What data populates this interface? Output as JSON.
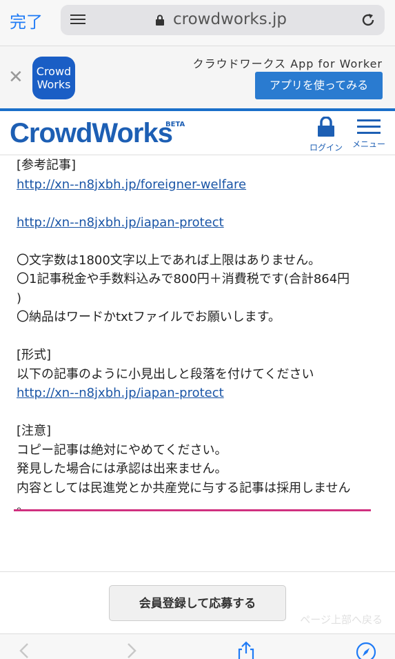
{
  "safari": {
    "done_label": "完了",
    "url": "crowdworks.jp"
  },
  "banner": {
    "logo_line1": "Crowd",
    "logo_line2": "Works",
    "title": "クラウドワークス App for Worker",
    "button_label": "アプリを使ってみる"
  },
  "header": {
    "logo_text": "CrowdWorks",
    "beta_label": "BETA",
    "login_label": "ログイン",
    "menu_label": "メニュー"
  },
  "content": {
    "lines": [
      {
        "text": "[参考記事]",
        "type": "text"
      },
      {
        "text": "http://xn--n8jxbh.jp/foreigner-welfare",
        "type": "link"
      },
      {
        "text": "",
        "type": "gap"
      },
      {
        "text": "http://xn--n8jxbh.jp/iapan-protect",
        "type": "link"
      },
      {
        "text": "",
        "type": "gap"
      },
      {
        "text": "〇文字数は1800文字以上であれば上限はありません。",
        "type": "text"
      },
      {
        "text": "〇1記事税金や手数料込みで800円＋消費税です(合計864円",
        "type": "text"
      },
      {
        "text": ")",
        "type": "text"
      },
      {
        "text": "〇納品はワードかtxtファイルでお願いします。",
        "type": "text"
      },
      {
        "text": "",
        "type": "gap"
      },
      {
        "text": "[形式]",
        "type": "text"
      },
      {
        "text": "以下の記事のように小見出しと段落を付けてください",
        "type": "text"
      },
      {
        "text": "http://xn--n8jxbh.jp/iapan-protect",
        "type": "link"
      },
      {
        "text": "",
        "type": "gap"
      },
      {
        "text": "[注意]",
        "type": "text"
      },
      {
        "text": "コピー記事は絶対にやめてください。",
        "type": "text"
      },
      {
        "text": "発見した場合には承認は出来ません。",
        "type": "text"
      },
      {
        "text": "内容としては民進党とか共産党に与する記事は採用しません",
        "type": "text"
      },
      {
        "text": "。",
        "type": "text"
      }
    ]
  },
  "bottom": {
    "apply_label": "会員登録して応募する",
    "page_top_label": "ページ上部へ戻る"
  },
  "colors": {
    "brand_blue": "#1d5fb4",
    "safari_blue": "#1f7bf6",
    "highlight_pink": "#d0307f"
  }
}
